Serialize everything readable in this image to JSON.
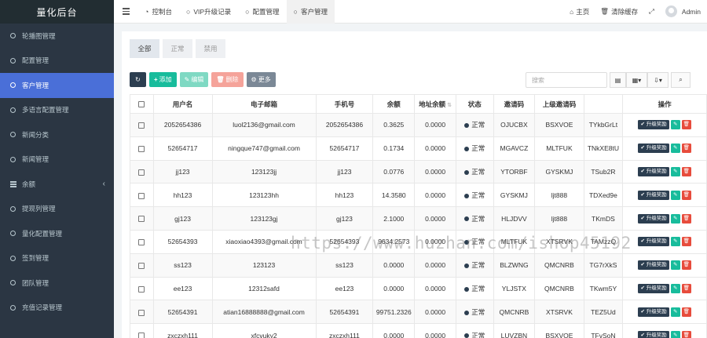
{
  "app": {
    "title": "量化后台"
  },
  "sidebar": {
    "items": [
      {
        "label": "轮播图管理",
        "icon": "circle-icon"
      },
      {
        "label": "配置管理",
        "icon": "circle-icon"
      },
      {
        "label": "客户管理",
        "icon": "circle-icon",
        "active": true
      },
      {
        "label": "多语言配置管理",
        "icon": "circle-icon"
      },
      {
        "label": "新闻分类",
        "icon": "circle-icon"
      },
      {
        "label": "新闻管理",
        "icon": "circle-icon"
      },
      {
        "label": "余额",
        "icon": "list-icon",
        "caret": "‹"
      },
      {
        "label": "提现列管理",
        "icon": "circle-icon"
      },
      {
        "label": "量化配置管理",
        "icon": "circle-icon"
      },
      {
        "label": "签到管理",
        "icon": "circle-icon"
      },
      {
        "label": "团队管理",
        "icon": "circle-icon"
      },
      {
        "label": "充值记录管理",
        "icon": "circle-icon"
      }
    ]
  },
  "topnav": {
    "tabs": [
      {
        "label": "控制台",
        "icon": "dashboard-icon"
      },
      {
        "label": "VIP升级记录",
        "icon": "circle-icon"
      },
      {
        "label": "配置管理",
        "icon": "circle-icon"
      },
      {
        "label": "客户管理",
        "icon": "circle-icon",
        "active": true
      }
    ],
    "right": {
      "home": "主页",
      "clear_cache": "清除缓存",
      "user": "Admin"
    }
  },
  "subtabs": [
    "全部",
    "正常",
    "禁用"
  ],
  "toolbar": {
    "add": "添加",
    "edit": "编辑",
    "delete": "删除",
    "more": "更多"
  },
  "search": {
    "placeholder": "搜索"
  },
  "table": {
    "headers": [
      "用户名",
      "电子邮箱",
      "手机号",
      "余额",
      "地址余额",
      "状态",
      "邀请码",
      "上级邀请码",
      "",
      "操作"
    ],
    "rows": [
      {
        "username": "2052654386",
        "email": "luol2136@gmail.com",
        "phone": "2052654386",
        "balance": "0.3625",
        "addr_balance": "0.0000",
        "status": "正常",
        "invite": "OJUCBX",
        "parent": "BSXVOE",
        "extra": "TYkbGrLt"
      },
      {
        "username": "52654717",
        "email": "ningque747@gmail.com",
        "phone": "52654717",
        "balance": "0.1734",
        "addr_balance": "0.0000",
        "status": "正常",
        "invite": "MGAVCZ",
        "parent": "MLTFUK",
        "extra": "TNkXE8tU"
      },
      {
        "username": "jj123",
        "email": "123123jj",
        "phone": "jj123",
        "balance": "0.0776",
        "addr_balance": "0.0000",
        "status": "正常",
        "invite": "YTORBF",
        "parent": "GYSKMJ",
        "extra": "TSub2R"
      },
      {
        "username": "hh123",
        "email": "123123hh",
        "phone": "hh123",
        "balance": "14.3580",
        "addr_balance": "0.0000",
        "status": "正常",
        "invite": "GYSKMJ",
        "parent": "ljt888",
        "extra": "TDXed9e"
      },
      {
        "username": "gj123",
        "email": "123123gj",
        "phone": "gj123",
        "balance": "2.1000",
        "addr_balance": "0.0000",
        "status": "正常",
        "invite": "HLJDVV",
        "parent": "ljt888",
        "extra": "TKmDS"
      },
      {
        "username": "52654393",
        "email": "xiaoxiao4393@gmail.com",
        "phone": "52654393",
        "balance": "9634.2573",
        "addr_balance": "0.0000",
        "status": "正常",
        "invite": "MLTFUK",
        "parent": "XTSRVK",
        "extra": "TAMzzQ"
      },
      {
        "username": "ss123",
        "email": "123123",
        "phone": "ss123",
        "balance": "0.0000",
        "addr_balance": "0.0000",
        "status": "正常",
        "invite": "BLZWNG",
        "parent": "QMCNRB",
        "extra": "TG7rXkS"
      },
      {
        "username": "ee123",
        "email": "12312safd",
        "phone": "ee123",
        "balance": "0.0000",
        "addr_balance": "0.0000",
        "status": "正常",
        "invite": "YLJSTX",
        "parent": "QMCNRB",
        "extra": "TKwm5Y"
      },
      {
        "username": "52654391",
        "email": "atian16888888@gmail.com",
        "phone": "52654391",
        "balance": "99751.2326",
        "addr_balance": "0.0000",
        "status": "正常",
        "invite": "QMCNRB",
        "parent": "XTSRVK",
        "extra": "TEZ5Ud"
      },
      {
        "username": "zxczxh111",
        "email": "xfcvuky2",
        "phone": "zxczxh111",
        "balance": "0.0000",
        "addr_balance": "0.0000",
        "status": "正常",
        "invite": "LUVZBN",
        "parent": "BSXVOE",
        "extra": "TFvSoN"
      }
    ],
    "row_actions": {
      "upgrade": "升级奖励"
    }
  },
  "watermark": "https://www.huzhan.com/ishop45192",
  "colors": {
    "sidebar_bg": "#2b3643",
    "active_blue": "#4a6fd8",
    "success": "#18bc9c",
    "danger": "#e74c3c",
    "dark": "#2c3e50"
  }
}
